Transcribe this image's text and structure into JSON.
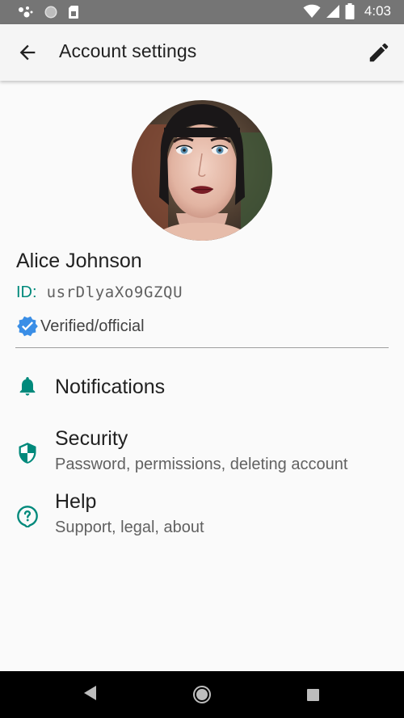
{
  "status_bar": {
    "time": "4:03",
    "icons": [
      "assistant-dots-icon",
      "circle-icon",
      "sim-card-icon",
      "wifi-icon",
      "signal-icon",
      "battery-icon"
    ]
  },
  "app_bar": {
    "title": "Account settings",
    "back_icon": "arrow-back-icon",
    "edit_icon": "pencil-icon"
  },
  "profile": {
    "name": "Alice Johnson",
    "id_label": "ID:",
    "id_value": "usrDlyaXo9GZQU",
    "verified_text": "Verified/official"
  },
  "menu": {
    "notifications": {
      "title": "Notifications",
      "icon": "bell-icon"
    },
    "security": {
      "title": "Security",
      "subtitle": "Password, permissions, deleting account",
      "icon": "shield-icon"
    },
    "help": {
      "title": "Help",
      "subtitle": "Support, legal, about",
      "icon": "help-icon"
    }
  },
  "colors": {
    "accent": "#00897b",
    "verified": "#3a8ee6",
    "status_bar": "#757575",
    "nav_bar": "#000000"
  }
}
